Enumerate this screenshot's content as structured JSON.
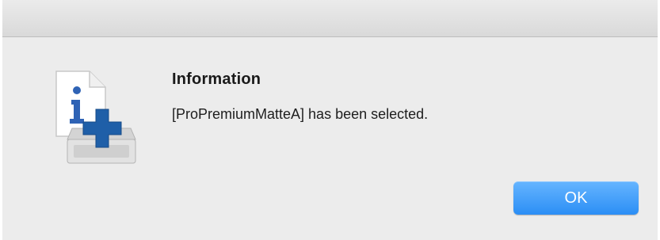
{
  "dialog": {
    "icon": "printer-info-add-icon",
    "title": "Information",
    "message": "[ProPremiumMatteA] has been selected.",
    "ok_label": "OK"
  },
  "colors": {
    "accent": "#2b8ef5",
    "dialog_background": "#ececec",
    "icon_blue": "#1f5fa8"
  }
}
